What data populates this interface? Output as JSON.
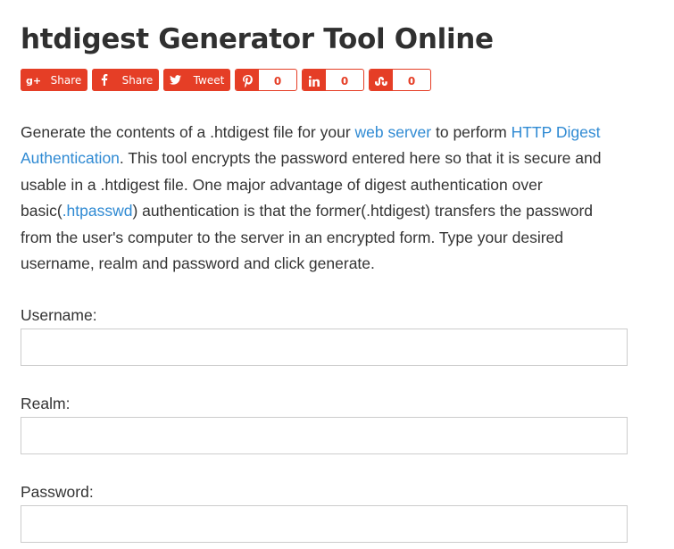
{
  "page": {
    "title": "htdigest Generator Tool Online"
  },
  "share": {
    "google_plus_label": "Share",
    "facebook_label": "Share",
    "twitter_label": "Tweet",
    "pinterest_count": "0",
    "linkedin_count": "0",
    "stumbleupon_count": "0",
    "accent_color": "#e53e26"
  },
  "description": {
    "part1": "Generate the contents of a .htdigest file for your ",
    "link1": "web server",
    "part2": " to perform ",
    "link2": "HTTP Digest Authentication",
    "part3": ". This tool encrypts the password entered here so that it is secure and usable in a .htdigest file. One major advantage of digest authentication over basic(",
    "link3": ".htpasswd",
    "part4": ") authentication is that the former(.htdigest) transfers the password from the user's computer to the server in an encrypted form. Type your desired username, realm and password and click generate.",
    "link_color": "#2f8ad3"
  },
  "form": {
    "username_label": "Username:",
    "username_value": "",
    "realm_label": "Realm:",
    "realm_value": "",
    "password_label": "Password:",
    "password_value": ""
  }
}
